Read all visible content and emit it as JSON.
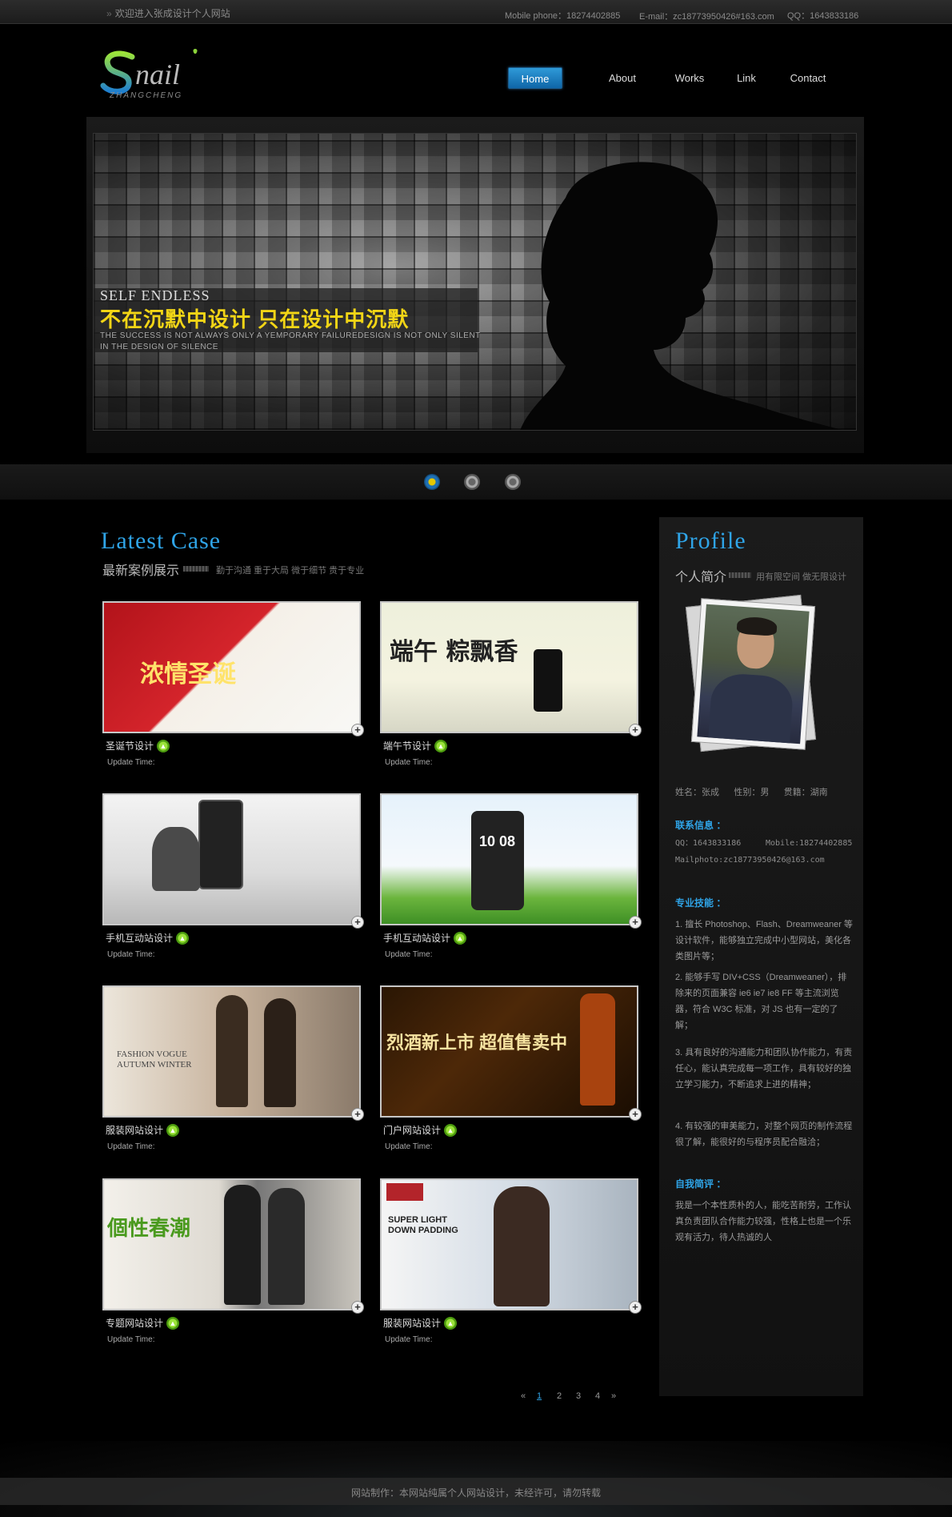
{
  "topbar": {
    "welcome": "欢迎进入张成设计个人网站",
    "phone": "Mobile phone：18274402885",
    "email": "E-mail：zc18773950426#163.com",
    "qq": "QQ：1643833186"
  },
  "logo": {
    "main": "Snail",
    "sub": "ZHANGCHENG"
  },
  "nav": [
    {
      "label": "Home",
      "active": true
    },
    {
      "label": "About"
    },
    {
      "label": "Works"
    },
    {
      "label": "Link"
    },
    {
      "label": "Contact"
    }
  ],
  "banner": {
    "title": "SELF ENDLESS",
    "main": "不在沉默中设计 只在设计中沉默",
    "sub": "THE SUCCESS IS NOT ALWAYS ONLY A YEMPORARY FAILUREDESIGN IS NOT ONLY SILENT IN THE DESIGN OF SILENCE",
    "dots": 3,
    "active_dot": 0
  },
  "latest": {
    "title": "Latest  Case",
    "subtitle": "最新案例展示",
    "tags": "勤于沟通  重于大局  微于细节  贵于专业",
    "update_label": "Update Time:",
    "cases": [
      {
        "name": "圣诞节设计",
        "thumb_text": "浓情圣诞"
      },
      {
        "name": "端午节设计",
        "thumb_text": "端午 粽飘香"
      },
      {
        "name": "手机互动站设计",
        "thumb_text": ""
      },
      {
        "name": "手机互动站设计",
        "thumb_text": "10 08"
      },
      {
        "name": "服装网站设计",
        "thumb_text": "FASHION VOGUE AUTUMN WINTER"
      },
      {
        "name": "门户网站设计",
        "thumb_text": "烈酒新上市 超值售卖中"
      },
      {
        "name": "专题网站设计",
        "thumb_text": "個性春潮"
      },
      {
        "name": "服装网站设计",
        "thumb_text": "SUPER LIGHT DOWN PADDING"
      }
    ]
  },
  "pager": {
    "first": "«",
    "pages": [
      "1",
      "2",
      "3",
      "4"
    ],
    "last": "»",
    "current": "1"
  },
  "profile": {
    "title": "Profile",
    "subtitle": "个人简介",
    "tags": "用有限空间  做无限设计",
    "basic": "姓名：张成      性别：男      贯籍：湖南",
    "contact_label": "联系信息 ：",
    "qq": "QQ：1643833186",
    "mobile": "Mobile:18274402885",
    "mail": "Mailphoto:zc18773950426@163.com",
    "skills_label": "专业技能 ：",
    "skills": [
      "1. 擅长 Photoshop、Flash、Dreamweaner 等设计软件，能够独立完成中小型网站，美化各类图片等；",
      "2. 能够手写 DIV+CSS（Dreamweaner），排除来的页面兼容 ie6 ie7 ie8 FF 等主流浏览器，符合 W3C 标准，对 JS 也有一定的了解；",
      "3. 具有良好的沟通能力和团队协作能力，有责任心，能认真完成每一项工作，具有较好的独立学习能力，不断追求上进的精神；",
      "4. 有较强的审美能力，对整个网页的制作流程很了解，能很好的与程序员配合融洽；"
    ],
    "self_label": "自我简评 ：",
    "self": "我是一个本性质朴的人，能吃苦耐劳，工作认真负责团队合作能力较强，性格上也是一个乐观有活力，待人热诚的人"
  },
  "footer": {
    "text": "网站制作：本网站纯属个人网站设计，未经许可，请勿转载"
  },
  "colors": {
    "accent": "#2fa4e7",
    "banner_yellow": "#f2d516",
    "go_green": "#7fce2a"
  }
}
